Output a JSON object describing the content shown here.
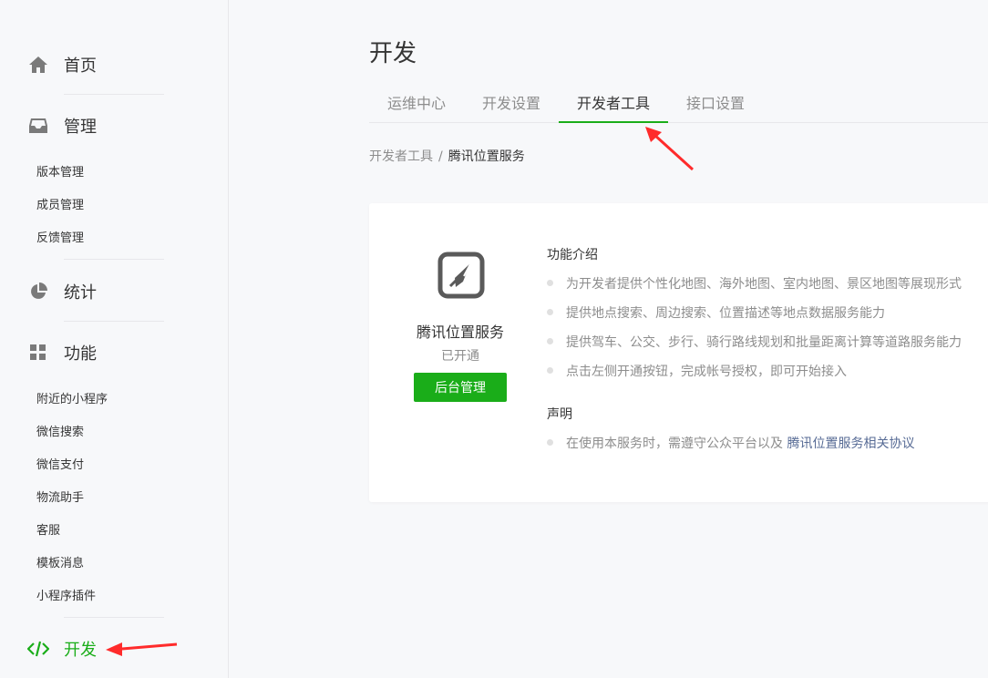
{
  "sidebar": {
    "home": "首页",
    "manage": "管理",
    "manage_items": [
      "版本管理",
      "成员管理",
      "反馈管理"
    ],
    "stats": "统计",
    "features": "功能",
    "feature_items": [
      "附近的小程序",
      "微信搜索",
      "微信支付",
      "物流助手",
      "客服",
      "模板消息",
      "小程序插件"
    ],
    "develop": "开发"
  },
  "main": {
    "title": "开发",
    "tabs": [
      "运维中心",
      "开发设置",
      "开发者工具",
      "接口设置"
    ],
    "active_tab": "开发者工具",
    "breadcrumb": {
      "parent": "开发者工具",
      "sep": "/",
      "current": "腾讯位置服务"
    }
  },
  "card": {
    "icon": "compass-icon",
    "name": "腾讯位置服务",
    "status": "已开通",
    "button": "后台管理",
    "intro_title": "功能介绍",
    "intro_items": [
      "为开发者提供个性化地图、海外地图、室内地图、景区地图等展现形式",
      "提供地点搜索、周边搜索、位置描述等地点数据服务能力",
      "提供驾车、公交、步行、骑行路线规划和批量距离计算等道路服务能力",
      "点击左侧开通按钮，完成帐号授权，即可开始接入"
    ],
    "statement_title": "声明",
    "statement_text": "在使用本服务时，需遵守公众平台以及",
    "statement_link": "腾讯位置服务相关协议"
  },
  "colors": {
    "accent": "#1aad19",
    "link": "#576b95",
    "arrow": "#ff2b2b"
  }
}
